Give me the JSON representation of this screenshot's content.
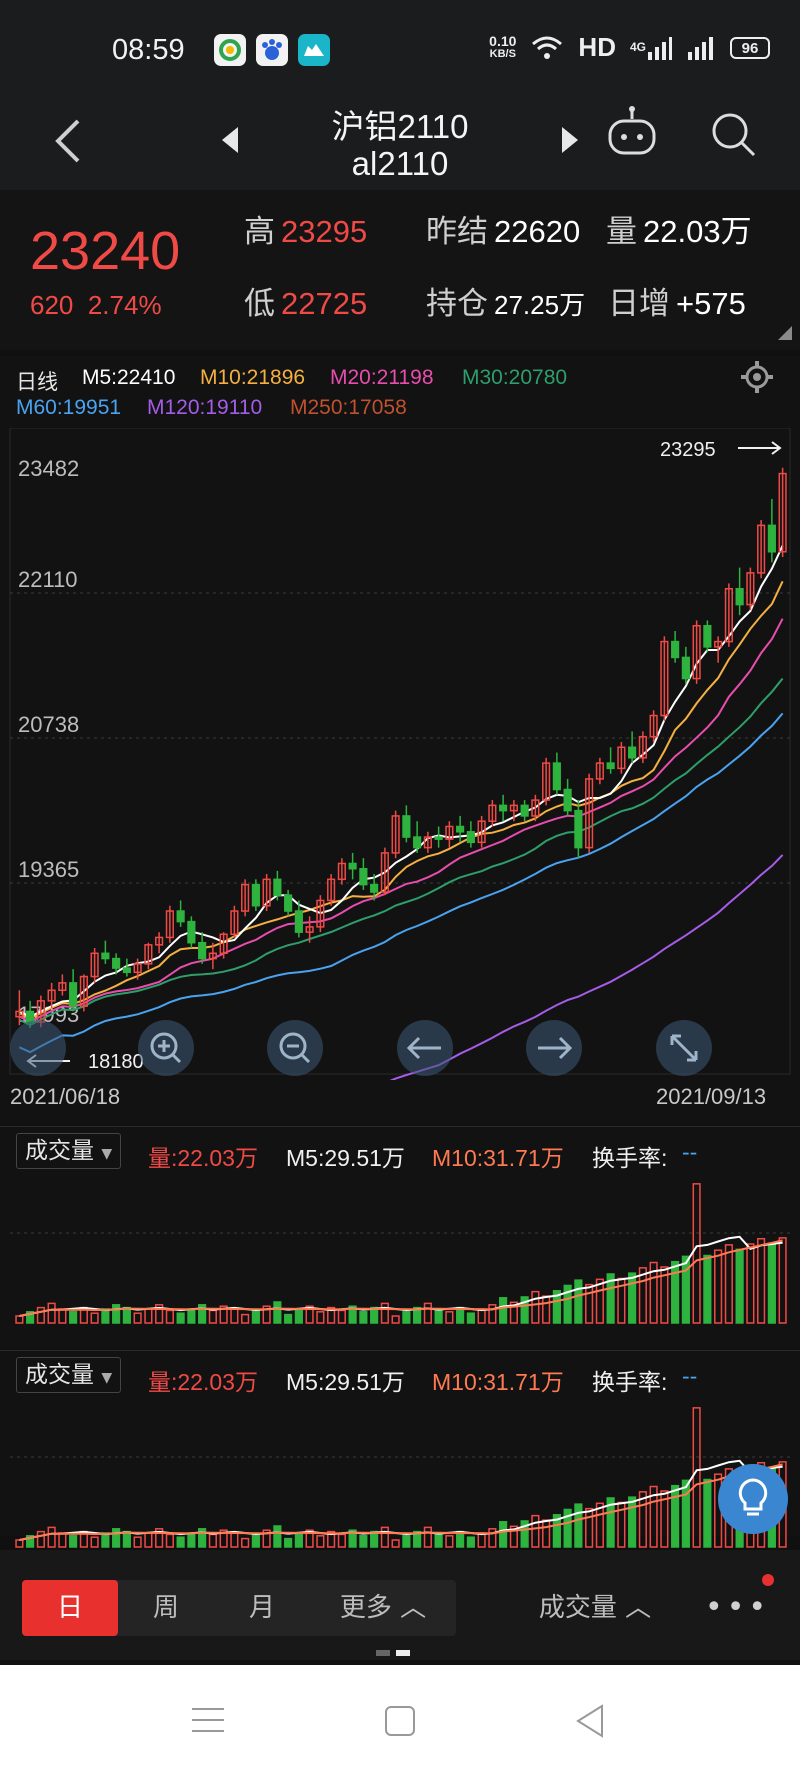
{
  "status": {
    "time": "08:59",
    "net_speed": "0.10",
    "net_unit": "KB/S",
    "hd": "HD",
    "signal": "4G",
    "battery": "96"
  },
  "nav": {
    "title_cn": "沪铝2110",
    "title_code": "al2110"
  },
  "quote": {
    "price": "23240",
    "change": "620",
    "change_pct": "2.74%",
    "high_label": "高",
    "high": "23295",
    "low_label": "低",
    "low": "22725",
    "prev_settle_label": "昨结",
    "prev_settle": "22620",
    "volume_label": "量",
    "volume": "22.03万",
    "open_int_label": "持仓",
    "open_int": "27.25万",
    "day_inc_label": "日增",
    "day_inc": "+575"
  },
  "ma_legend": [
    {
      "text": "日线",
      "color": "#e6e6e6"
    },
    {
      "text": "M5:22410",
      "color": "#ffffff"
    },
    {
      "text": "M10:21896",
      "color": "#f5b041"
    },
    {
      "text": "M20:21198",
      "color": "#e84dae"
    },
    {
      "text": "M30:20780",
      "color": "#2e9e6a"
    },
    {
      "text": "M60:19951",
      "color": "#4aa3f0"
    },
    {
      "text": "M120:19110",
      "color": "#a55ce8"
    },
    {
      "text": "M250:17058",
      "color": "#c0512f"
    }
  ],
  "kchart": {
    "y_ticks": [
      "23482",
      "22110",
      "20738",
      "19365",
      "17993"
    ],
    "high_marker": "23295",
    "low_marker": "18180",
    "start_date": "2021/06/18",
    "end_date": "2021/09/13"
  },
  "volume_panels": [
    {
      "selector": "成交量",
      "vol": "量:22.03万",
      "m5": "M5:29.51万",
      "m10": "M10:31.71万",
      "turnover": "换手率:",
      "turnover_val": "--"
    },
    {
      "selector": "成交量",
      "vol": "量:22.03万",
      "m5": "M5:29.51万",
      "m10": "M10:31.71万",
      "turnover": "换手率:",
      "turnover_val": "--"
    }
  ],
  "tabs": {
    "day": "日",
    "week": "周",
    "month": "月",
    "more": "更多",
    "indicator": "成交量"
  },
  "chart_data": {
    "type": "candlestick",
    "title": "日线",
    "x_start": "2021/06/18",
    "x_end": "2021/09/13",
    "ylim": [
      17993,
      23482
    ],
    "candles": [
      [
        18100,
        18350,
        18020,
        18150
      ],
      [
        18150,
        18250,
        17993,
        18050
      ],
      [
        18050,
        18300,
        18000,
        18250
      ],
      [
        18250,
        18420,
        18180,
        18350
      ],
      [
        18350,
        18500,
        18300,
        18420
      ],
      [
        18420,
        18550,
        18150,
        18200
      ],
      [
        18200,
        18500,
        18150,
        18480
      ],
      [
        18480,
        18750,
        18420,
        18700
      ],
      [
        18700,
        18820,
        18600,
        18650
      ],
      [
        18650,
        18700,
        18500,
        18560
      ],
      [
        18560,
        18650,
        18480,
        18520
      ],
      [
        18520,
        18650,
        18450,
        18600
      ],
      [
        18600,
        18800,
        18550,
        18780
      ],
      [
        18780,
        18900,
        18700,
        18850
      ],
      [
        18850,
        19150,
        18800,
        19100
      ],
      [
        19100,
        19200,
        18950,
        19000
      ],
      [
        19000,
        19050,
        18750,
        18800
      ],
      [
        18800,
        18900,
        18600,
        18650
      ],
      [
        18650,
        18800,
        18550,
        18700
      ],
      [
        18700,
        18900,
        18650,
        18880
      ],
      [
        18880,
        19150,
        18850,
        19100
      ],
      [
        19100,
        19400,
        19050,
        19350
      ],
      [
        19350,
        19400,
        19100,
        19150
      ],
      [
        19150,
        19450,
        19100,
        19400
      ],
      [
        19400,
        19480,
        19200,
        19250
      ],
      [
        19250,
        19300,
        19050,
        19100
      ],
      [
        19100,
        19200,
        18850,
        18900
      ],
      [
        18900,
        19050,
        18800,
        18950
      ],
      [
        18950,
        19250,
        18900,
        19200
      ],
      [
        19200,
        19450,
        19150,
        19400
      ],
      [
        19400,
        19600,
        19350,
        19550
      ],
      [
        19550,
        19650,
        19400,
        19500
      ],
      [
        19500,
        19600,
        19300,
        19350
      ],
      [
        19350,
        19450,
        19200,
        19280
      ],
      [
        19280,
        19700,
        19250,
        19650
      ],
      [
        19650,
        20050,
        19600,
        20000
      ],
      [
        20000,
        20100,
        19750,
        19800
      ],
      [
        19800,
        19950,
        19650,
        19700
      ],
      [
        19700,
        19850,
        19650,
        19800
      ],
      [
        19800,
        19900,
        19700,
        19780
      ],
      [
        19780,
        19950,
        19700,
        19900
      ],
      [
        19900,
        20000,
        19750,
        19850
      ],
      [
        19850,
        19950,
        19700,
        19750
      ],
      [
        19750,
        20000,
        19700,
        19950
      ],
      [
        19950,
        20150,
        19900,
        20100
      ],
      [
        20100,
        20200,
        19950,
        20050
      ],
      [
        20050,
        20150,
        19950,
        20100
      ],
      [
        20100,
        20150,
        19950,
        20000
      ],
      [
        20000,
        20200,
        19950,
        20150
      ],
      [
        20150,
        20550,
        20100,
        20500
      ],
      [
        20500,
        20600,
        20200,
        20250
      ],
      [
        20250,
        20350,
        20000,
        20050
      ],
      [
        20050,
        20150,
        19600,
        19700
      ],
      [
        19700,
        20400,
        19650,
        20350
      ],
      [
        20350,
        20550,
        20300,
        20500
      ],
      [
        20500,
        20650,
        20400,
        20450
      ],
      [
        20450,
        20700,
        20400,
        20650
      ],
      [
        20650,
        20800,
        20500,
        20550
      ],
      [
        20550,
        20800,
        20500,
        20750
      ],
      [
        20750,
        21000,
        20700,
        20950
      ],
      [
        20950,
        21700,
        20900,
        21650
      ],
      [
        21650,
        21750,
        21450,
        21500
      ],
      [
        21500,
        21600,
        21250,
        21300
      ],
      [
        21300,
        21850,
        21250,
        21800
      ],
      [
        21800,
        21850,
        21550,
        21600
      ],
      [
        21600,
        21700,
        21450,
        21650
      ],
      [
        21650,
        22200,
        21600,
        22150
      ],
      [
        22150,
        22350,
        21900,
        22000
      ],
      [
        22000,
        22350,
        21950,
        22300
      ],
      [
        22300,
        22800,
        22250,
        22750
      ],
      [
        22750,
        23000,
        22400,
        22500
      ],
      [
        22500,
        23295,
        22450,
        23240
      ]
    ],
    "ma": {
      "M5": 22410,
      "M10": 21896,
      "M20": 21198,
      "M30": 20780,
      "M60": 19951,
      "M120": 19110,
      "M250": 17058
    }
  }
}
